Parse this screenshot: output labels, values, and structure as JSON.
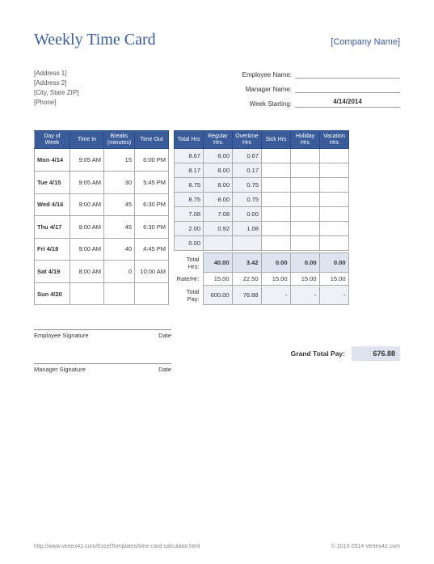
{
  "title": "Weekly Time Card",
  "company": "[Company Name]",
  "address": {
    "line1": "[Address 1]",
    "line2": "[Address 2]",
    "line3": "[City, State ZIP]",
    "phone": "[Phone]"
  },
  "fields": {
    "employee_label": "Employee Name:",
    "employee_value": "",
    "manager_label": "Manager Name:",
    "manager_value": "",
    "week_label": "Week Starting:",
    "week_value": "4/14/2014"
  },
  "left_headers": {
    "day": "Day of Week",
    "in": "Time In",
    "breaks": "Breaks (minutes)",
    "out": "Time Out"
  },
  "right_headers": {
    "total": "Total Hrs",
    "regular": "Regular Hrs",
    "overtime": "Overtime Hrs",
    "sick": "Sick Hrs",
    "holiday": "Holiday Hrs",
    "vacation": "Vacation Hrs"
  },
  "rows": [
    {
      "day": "Mon 4/14",
      "in": "9:05 AM",
      "br": "15",
      "out": "6:00 PM",
      "tot": "8.67",
      "reg": "8.00",
      "ot": "0.67",
      "sick": "",
      "hol": "",
      "vac": ""
    },
    {
      "day": "Tue 4/15",
      "in": "9:05 AM",
      "br": "30",
      "out": "5:45 PM",
      "tot": "8.17",
      "reg": "8.00",
      "ot": "0.17",
      "sick": "",
      "hol": "",
      "vac": ""
    },
    {
      "day": "Wed 4/16",
      "in": "9:00 AM",
      "br": "45",
      "out": "6:30 PM",
      "tot": "8.75",
      "reg": "8.00",
      "ot": "0.75",
      "sick": "",
      "hol": "",
      "vac": ""
    },
    {
      "day": "Thu 4/17",
      "in": "9:00 AM",
      "br": "45",
      "out": "6:30 PM",
      "tot": "8.75",
      "reg": "8.00",
      "ot": "0.75",
      "sick": "",
      "hol": "",
      "vac": ""
    },
    {
      "day": "Fri 4/18",
      "in": "9:00 AM",
      "br": "40",
      "out": "4:45 PM",
      "tot": "7.08",
      "reg": "7.08",
      "ot": "0.00",
      "sick": "",
      "hol": "",
      "vac": ""
    },
    {
      "day": "Sat 4/19",
      "in": "8:00 AM",
      "br": "0",
      "out": "10:00 AM",
      "tot": "2.00",
      "reg": "0.92",
      "ot": "1.08",
      "sick": "",
      "hol": "",
      "vac": ""
    },
    {
      "day": "Sun 4/20",
      "in": "",
      "br": "",
      "out": "",
      "tot": "0.00",
      "reg": "",
      "ot": "",
      "sick": "",
      "hol": "",
      "vac": ""
    }
  ],
  "totals": {
    "label": "Total Hrs:",
    "reg": "40.00",
    "ot": "3.42",
    "sick": "0.00",
    "hol": "0.00",
    "vac": "0.00"
  },
  "rate": {
    "label": "Rate/Hr:",
    "reg": "15.00",
    "ot": "22.50",
    "sick": "15.00",
    "hol": "15.00",
    "vac": "15.00"
  },
  "pay": {
    "label": "Total Pay:",
    "reg": "600.00",
    "ot": "76.88",
    "sick": "-",
    "hol": "-",
    "vac": "-"
  },
  "sig": {
    "emp": "Employee Signature",
    "mgr": "Manager Signature",
    "date": "Date"
  },
  "grand": {
    "label": "Grand Total Pay:",
    "value": "676.88"
  },
  "footer": {
    "url": "http://www.vertex42.com/ExcelTemplates/time-card-calculator.html",
    "copyright": "© 2010-2014 Vertex42.com"
  }
}
